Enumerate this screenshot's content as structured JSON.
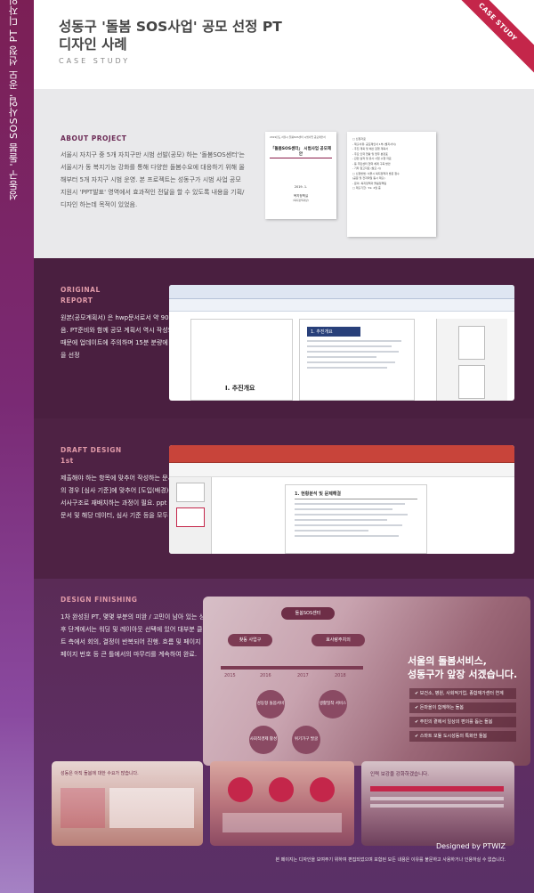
{
  "sidebar": {
    "title": "성동구 '돌봄 SOS사업' 공모 선정 PT 디자인 사례"
  },
  "header": {
    "title_line1": "성동구 '돌봄 SOS사업' 공모 선정 PT",
    "title_line2": "디자인 사례",
    "subtitle": "CASE STUDY",
    "ribbon": "CASE STUDY"
  },
  "about": {
    "label": "ABOUT PROJECT",
    "text": "서울시 자치구 중 5개 자치구만 시범 선발(공모) 하는 '돌봄SOS센터'는 서울시가 동 복지기능 강화를 통해 다양한 돌봄수요에 대응하기 위해 올해부터 5개 자치구 시범 운영. 본 프로젝트는 성동구가 시범 사업 공모 지원시 'PPT발표' 영역에서 효과적인 전달을 할 수 있도록 내용을 기획/디자인 하는데 목적이 있었음.",
    "doc_cover": {
      "header_small": "2019년도 서울시 돌봄SOS센터 시범사업 공모제안서",
      "title": "「돌봄SOS센터」 시범사업 공모제안",
      "date": "2019. 1.",
      "org": "복지정책실",
      "org_sub": "(복지정책과장)"
    },
    "doc_list": [
      "□ 신청자료",
      "- 제출서류: 공모제안서 1부 (별지서식)",
      "- 추진 계획 및 예산 집행 계획서",
      "- 주요 인력 현황 및 업무 분장표",
      "- 관련 실적 및 유사 사업 수행 자료",
      "- 동 주민센터 협력 체계 구축 방안",
      "- 기타 참고자료 (필요 시)",
      "",
      "□ 신청방법: 서울시 복지정책과 방문 접수",
      "  (공문 및 전자파일 동시 제출)",
      "",
      "- 문의: 복지정책과 돌봄정책팀",
      "",
      "□ 제출기한: '19. 2월 중"
    ]
  },
  "original": {
    "label_line1": "ORIGINAL",
    "label_line2": "REPORT",
    "text": "원본(공모계획서) 은 hwp문서로서 약 90페이지에 달했음. PT준비와 함께 공모 계획서 역시 작성되는 중이었기 때문에 업데이트에 주의하며 15분 분량에 맞게 중요 항목을 선정",
    "page_heading": "Ⅰ. 추진개요",
    "side_heading": "1. 추진개요"
  },
  "draft": {
    "label_line1": "DRAFT DESIGN",
    "label_line2": "1st",
    "text": "제출해야 하는 항목에 맞추어 작성하는 문서와는 달리 PT의 경우 [심사 기준]에 맞추어 [도입(배경)-본론-결론] 의 서사구조로 재배치하는 과정이 필요. ppt 문서 상에 원본 문서 및 해당 데이터, 심사 기준 등을 모두 수집",
    "slide_heading": "1. 현황분석 및 문제해결"
  },
  "design": {
    "label": "DESIGN FINISHING",
    "text": "1차 완성된 PT, 몇몇 부분의 미완 / 고민이 남아 있는 상태, 이 후 단계에서는 워딩 및 레이아웃 선택에 있어 대부분 클라이언트 측에서 회의, 결정이 반복되어 진행. 흐름 및 페이지 전환, 페이지 번호 등 큰 틀에서의 마무리를 계속하여 완료.",
    "timeline_pills": [
      "찾동 사업구",
      "돌봄SOS센터",
      "효사랑주치의"
    ],
    "years": [
      "2015",
      "2016",
      "2017",
      "2018"
    ],
    "circles": [
      "성동형 돌봄서비스",
      "생활밀착 서비스",
      "사회적경제 활성화",
      "위기가구 발굴"
    ],
    "headline_line1": "서울의 돌봄서비스,",
    "headline_line2": "성동구가 앞장 서겠습니다.",
    "checks": [
      "✔ 보건소, 병원, 사회적기업, 종합재가센터 연계",
      "✔ 돈마을이 함께하는 돌봄",
      "✔ 주민의 곁에서 일상의 편의를 돕는 돌봄",
      "✔ 스마트 모듈 도시성동의 특화한 돌봄"
    ],
    "thumb1_title": "성동은 아직 돌봄에 대한 수요가 많습니다.",
    "thumb3_title": "인력 보강을 강화하겠습니다.",
    "brand": "Designed by PTWIZ",
    "note": "본 페이지는 디자인을 보여주기 위하여 편집되었으며 포함된 모든 내용은 이유를 불문하고 사용하거나 인용하실 수 없습니다."
  },
  "colors": {
    "accent": "#c4264a",
    "label_pink": "#e09aa8",
    "section_dark": "#4a1f40"
  }
}
